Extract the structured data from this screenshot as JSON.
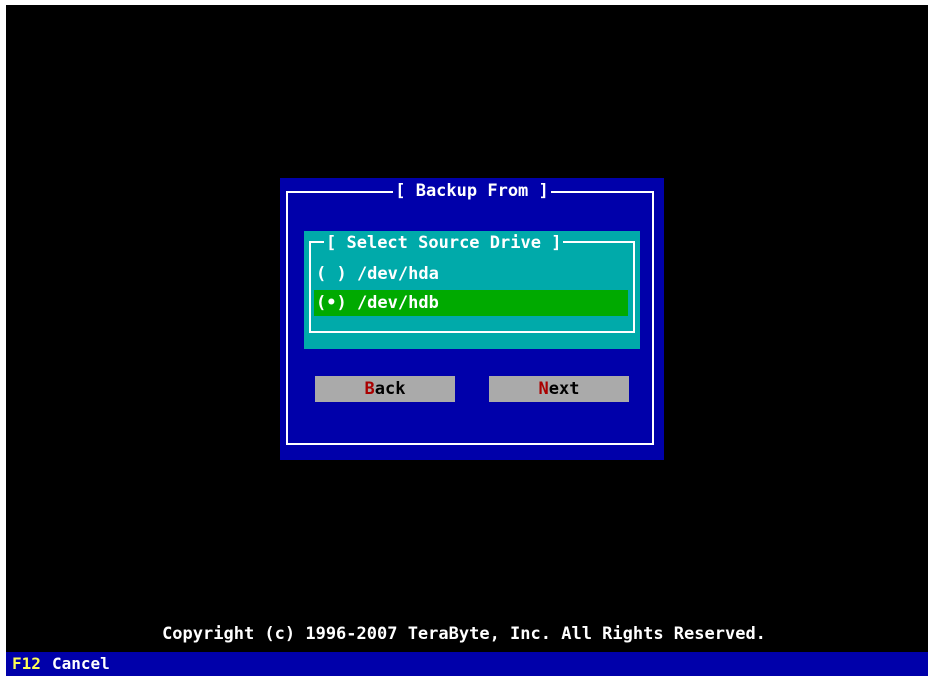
{
  "dialog": {
    "title": "Backup From",
    "panel": {
      "title": "Select Source Drive",
      "drives": [
        {
          "label": "( ) /dev/hda",
          "selected": false
        },
        {
          "label": "(•) /dev/hdb",
          "selected": true
        }
      ]
    },
    "buttons": {
      "back": {
        "hotkey": "B",
        "rest": "ack"
      },
      "next": {
        "hotkey": "N",
        "rest": "ext"
      }
    }
  },
  "footer": {
    "copyright": "Copyright (c) 1996-2007 TeraByte, Inc.  All Rights Reserved."
  },
  "statusbar": {
    "key": "F12",
    "action": "Cancel"
  },
  "colors": {
    "background": "#000000",
    "dialog": "#0000aa",
    "panel": "#00aaaa",
    "selected": "#00aa00",
    "button": "#aaaaaa",
    "hotkey": "#aa0000",
    "status_key": "#ffff55"
  }
}
